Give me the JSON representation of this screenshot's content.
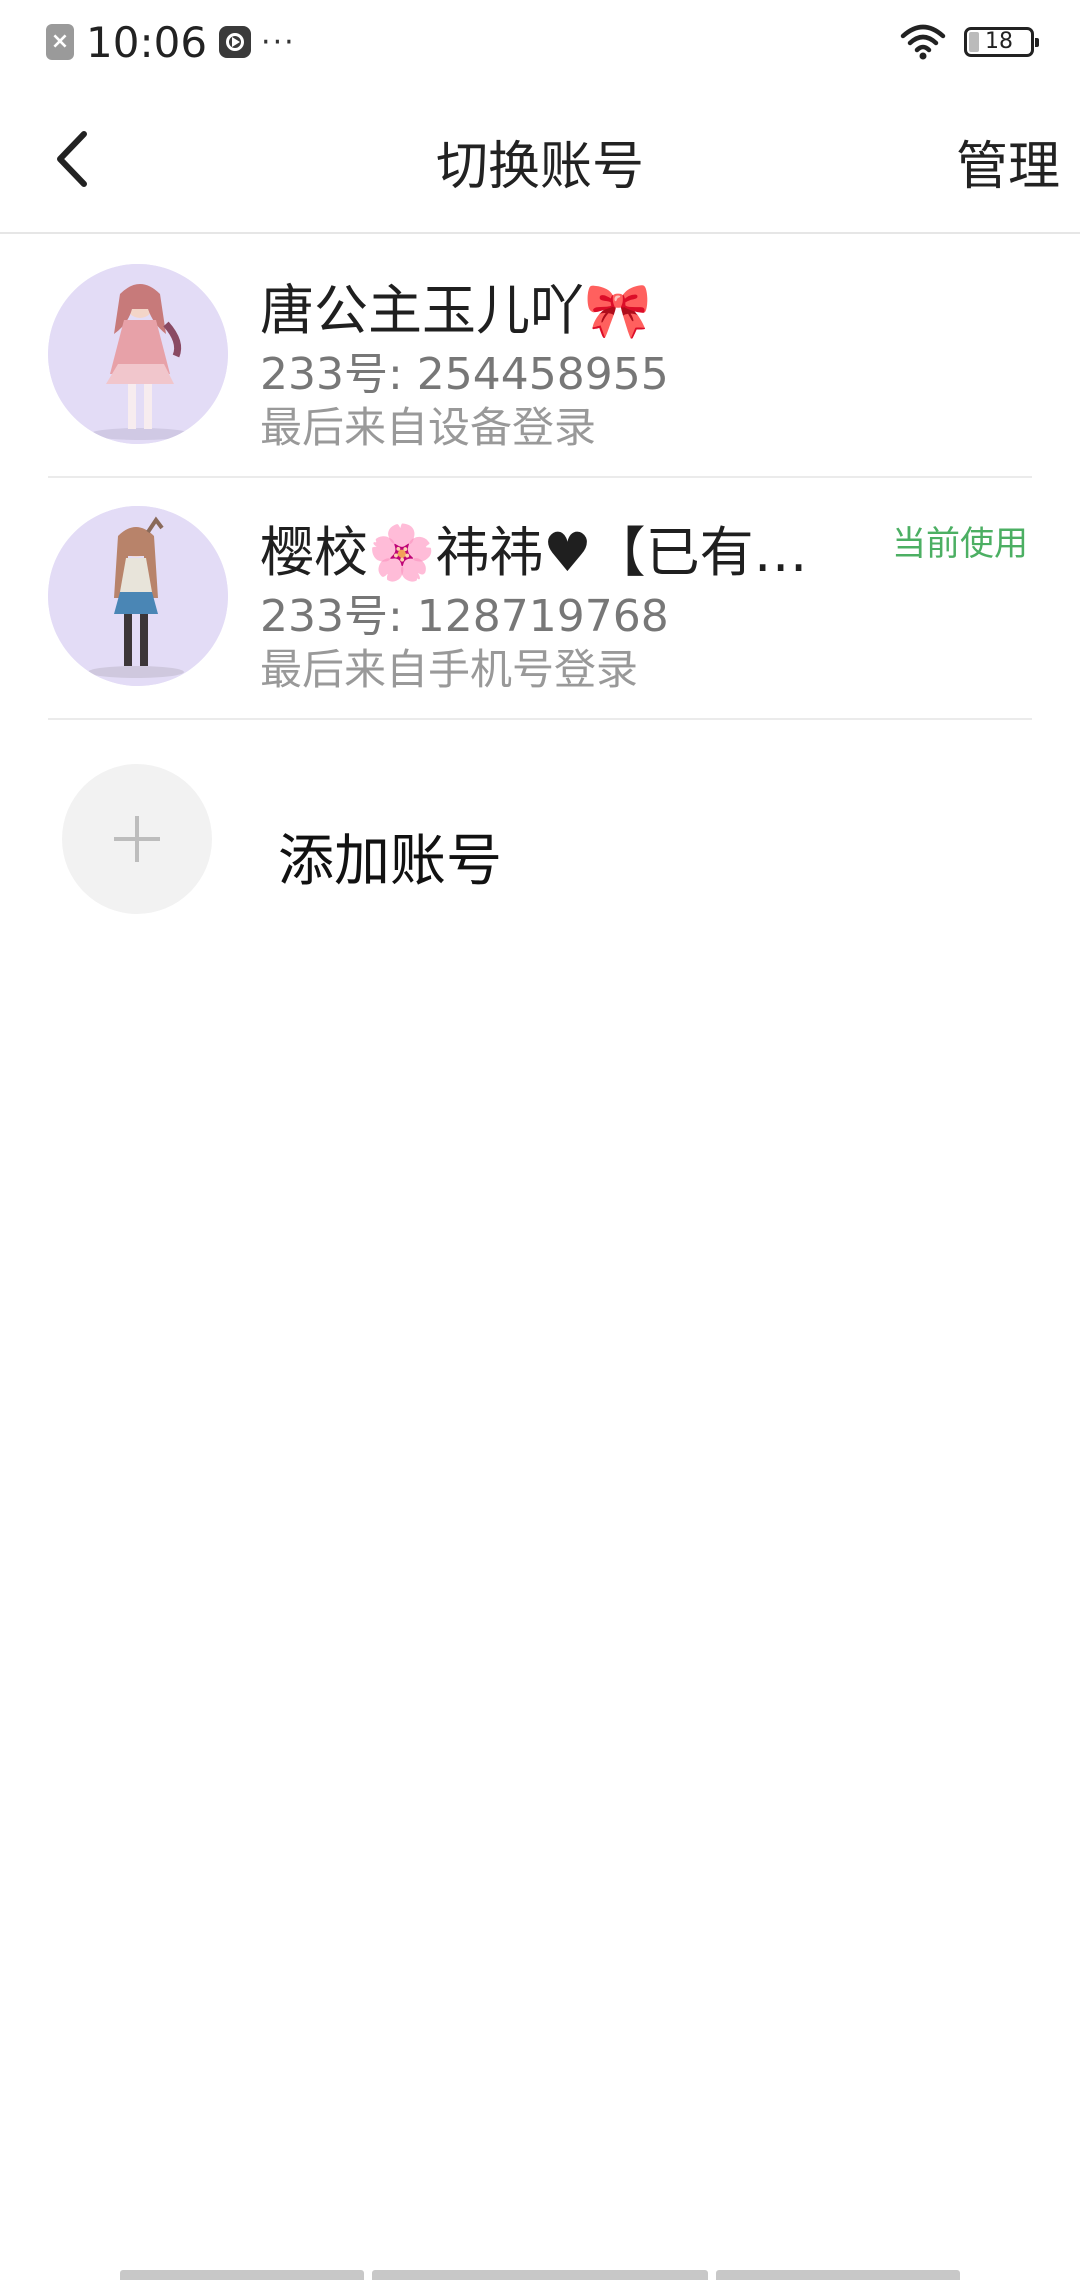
{
  "status_bar": {
    "time": "10:06",
    "dots": "···",
    "battery": "18"
  },
  "navbar": {
    "title": "切换账号",
    "manage_label": "管理"
  },
  "accounts": [
    {
      "name": "唐公主玉儿吖🎀",
      "id": "233号: 254458955",
      "login": "最后来自设备登录",
      "current": ""
    },
    {
      "name": "樱校🌸祎祎♥【已有…",
      "id": "233号: 128719768",
      "login": "最后来自手机号登录",
      "current": "当前使用"
    }
  ],
  "add_account": {
    "label": "添加账号"
  },
  "colors": {
    "current_badge": "#4caf63",
    "avatar_bg": "#e3dcf6"
  }
}
